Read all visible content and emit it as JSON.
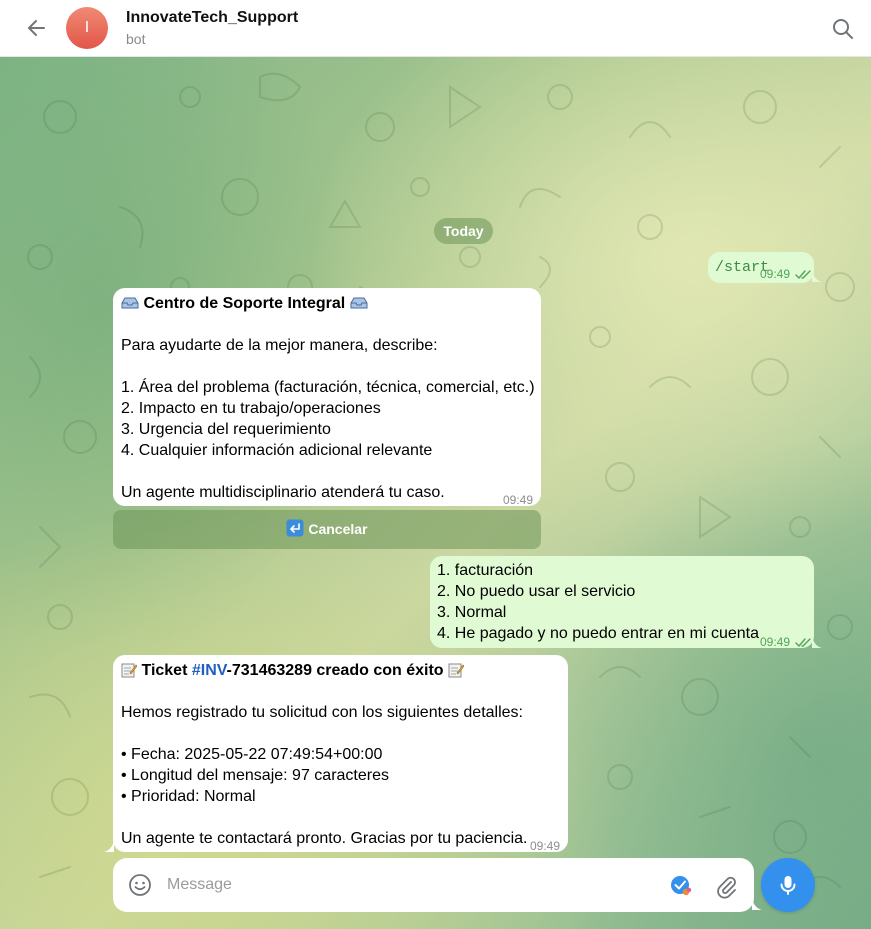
{
  "header": {
    "chat_title": "InnovateTech_Support",
    "chat_subtitle": "bot",
    "avatar_letter": "I",
    "icons": [
      "back-arrow-icon",
      "search-icon"
    ]
  },
  "date_separator": "Today",
  "messages": {
    "m1": {
      "direction": "outgoing",
      "text": "/start",
      "time": "09:49",
      "status": "read"
    },
    "m2": {
      "direction": "incoming",
      "title": "Centro de Soporte Integral",
      "text": "Para ayudarte de la mejor manera, describe:\n\n1. Área del problema (facturación, técnica, comercial, etc.)\n2. Impacto en tu trabajo/operaciones\n3. Urgencia del requerimiento\n4. Cualquier información adicional relevante\n\nUn agente multidisciplinario atenderá tu caso.",
      "time": "09:49",
      "inline_button": "Cancelar"
    },
    "m3": {
      "direction": "outgoing",
      "text": "1. facturación\n2. No puedo usar el servicio\n3. Normal\n4. He pagado y no puedo entrar en mi cuenta",
      "time": "09:49",
      "status": "read"
    },
    "m4": {
      "direction": "incoming",
      "title_prefix": "Ticket",
      "hashtag": "#INV",
      "title_suffix": "-731463289 creado con éxito",
      "text": "Hemos registrado tu solicitud con los siguientes detalles:\n\n• Fecha: 2025-05-22 07:49:54+00:00\n• Longitud del mensaje: 97 caracteres\n• Prioridad: Normal\n\nUn agente te contactará pronto. Gracias por tu paciencia.",
      "time": "09:49"
    }
  },
  "composer": {
    "placeholder": "Message",
    "value": "",
    "icons": [
      "emoji-icon",
      "bot-command-icon",
      "paperclip-icon",
      "microphone-icon"
    ]
  },
  "colors": {
    "outgoing_bubble": "#e0fbd3",
    "incoming_bubble": "#ffffff",
    "accent": "#3390ec",
    "hashtag": "#1f5fbf",
    "avatar": "#e2564a"
  }
}
